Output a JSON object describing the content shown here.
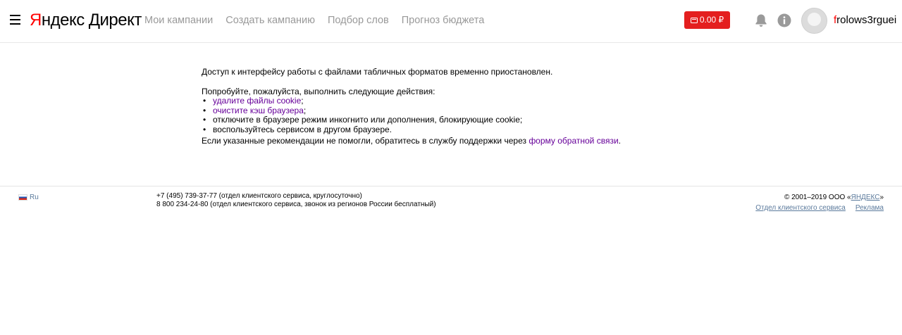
{
  "header": {
    "logo_first_letter": "Я",
    "logo_rest": "ндекс",
    "logo_product": "Директ",
    "nav": [
      {
        "label": "Мои кампании"
      },
      {
        "label": "Создать кампанию"
      },
      {
        "label": "Подбор слов"
      },
      {
        "label": "Прогноз бюджета"
      }
    ],
    "balance": "0.00 ₽",
    "username_first": "f",
    "username_rest": "rolows3rguei"
  },
  "message": {
    "lead": "Доступ к интерфейсу работы с файлами табличных форматов временно приостановлен.",
    "intro": "Попробуйте, пожалуйста, выполнить следующие действия:",
    "items": [
      {
        "link": "удалите файлы cookie",
        "suffix": ";"
      },
      {
        "link": "очистите кэш браузера",
        "suffix": ";"
      },
      {
        "text": "отключите в браузере режим инкогнито или дополнения, блокирующие cookie;"
      },
      {
        "text": "воспользуйтесь сервисом в другом браузере."
      }
    ],
    "support_text": "Если указанные рекомендации не помогли, обратитесь в службу поддержки через ",
    "support_link": "форму обратной связи",
    "support_end": "."
  },
  "footer": {
    "lang": "Ru",
    "phone1": "+7 (495) 739-37-77 (отдел клиентского сервиса, круглосуточно)",
    "phone2": "8 800 234-24-80 (отдел клиентского сервиса, звонок из регионов России бесплатный)",
    "copyright_prefix": "© 2001–2019  ООО «",
    "copyright_link": "ЯНДЕКС",
    "copyright_suffix": "»",
    "links": [
      {
        "label": "Отдел клиентского сервиса"
      },
      {
        "label": "Реклама"
      }
    ]
  },
  "colors": {
    "brand_red": "#e41f1f",
    "nav_gray": "#999999",
    "visited_link": "#660099",
    "footer_link": "#5b7a9c"
  }
}
